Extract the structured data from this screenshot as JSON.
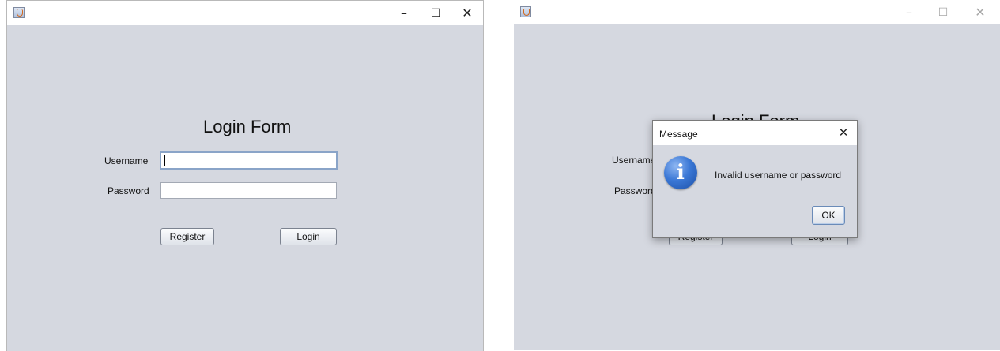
{
  "left_window": {
    "form_title": "Login Form",
    "username_label": "Username",
    "password_label": "Password",
    "username_value": "",
    "password_value": "",
    "register_label": "Register",
    "login_label": "Login",
    "window_controls": {
      "minimize": "–",
      "maximize": "☐",
      "close": "✕"
    }
  },
  "right_window": {
    "form_title": "Login Form",
    "username_label": "Username",
    "password_label": "Password",
    "register_label": "Register",
    "login_label": "Login",
    "window_controls": {
      "minimize": "–",
      "maximize": "☐",
      "close": "✕"
    },
    "dialog": {
      "title": "Message",
      "close_glyph": "✕",
      "icon": "info-icon",
      "icon_glyph": "i",
      "message": "Invalid username or password",
      "ok_label": "OK"
    }
  },
  "colors": {
    "panel_background": "#d5d8e0",
    "titlebar_background": "#ffffff",
    "info_icon_blue": "#3b78d6"
  }
}
